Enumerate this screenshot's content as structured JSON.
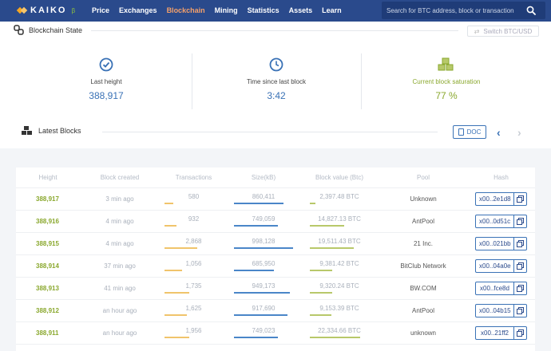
{
  "nav": {
    "logo": "KAIKO",
    "beta": "β",
    "links": [
      "Price",
      "Exchanges",
      "Blockchain",
      "Mining",
      "Statistics",
      "Assets",
      "Learn"
    ],
    "search_placeholder": "Search for BTC address, block or transaction"
  },
  "state": {
    "title": "Blockchain State",
    "switch_label": "Switch BTC/USD"
  },
  "stats": [
    {
      "label": "Last height",
      "value": "388,917"
    },
    {
      "label": "Time since last block",
      "value": "3:42"
    },
    {
      "label": "Current block saturation",
      "value": "77 %"
    }
  ],
  "latest": {
    "title": "Latest Blocks",
    "doc_label": "DOC"
  },
  "table": {
    "headers": [
      "Height",
      "Block created",
      "Transactions",
      "Size(kB)",
      "Block value (Btc)",
      "Pool",
      "Hash"
    ],
    "rows": [
      {
        "height": "388,917",
        "created": "3 min ago",
        "tx": "580",
        "size": "860,411",
        "value": "2,397.48 BTC",
        "pool": "Unknown",
        "hash": "x00..2e1d8"
      },
      {
        "height": "388,916",
        "created": "4 min ago",
        "tx": "932",
        "size": "749,059",
        "value": "14,827.13 BTC",
        "pool": "AntPool",
        "hash": "x00..0d51c"
      },
      {
        "height": "388,915",
        "created": "4 min ago",
        "tx": "2,868",
        "size": "998,128",
        "value": "19,511.43 BTC",
        "pool": "21 Inc.",
        "hash": "x00..021bb"
      },
      {
        "height": "388,914",
        "created": "37 min ago",
        "tx": "1,056",
        "size": "685,950",
        "value": "9,381.42 BTC",
        "pool": "BitClub Network",
        "hash": "x00..04a0e"
      },
      {
        "height": "388,913",
        "created": "41 min ago",
        "tx": "1,735",
        "size": "949,173",
        "value": "9,320.24 BTC",
        "pool": "BW.COM",
        "hash": "x00..fce8d"
      },
      {
        "height": "388,912",
        "created": "an hour ago",
        "tx": "1,625",
        "size": "917,690",
        "value": "9,153.39 BTC",
        "pool": "AntPool",
        "hash": "x00..04b15"
      },
      {
        "height": "388,911",
        "created": "an hour ago",
        "tx": "1,956",
        "size": "749,023",
        "value": "22,334.66 BTC",
        "pool": "unknown",
        "hash": "x00..21ff2"
      }
    ]
  },
  "colors": {
    "nav_bg": "#2a4a8c",
    "accent_blue": "#3a72b6",
    "accent_green": "#8aa82e",
    "active_link": "#f5a06a",
    "tx_bar": "#f0c46b",
    "size_bar": "#4a86c8",
    "value_bar": "#b8c86a"
  }
}
